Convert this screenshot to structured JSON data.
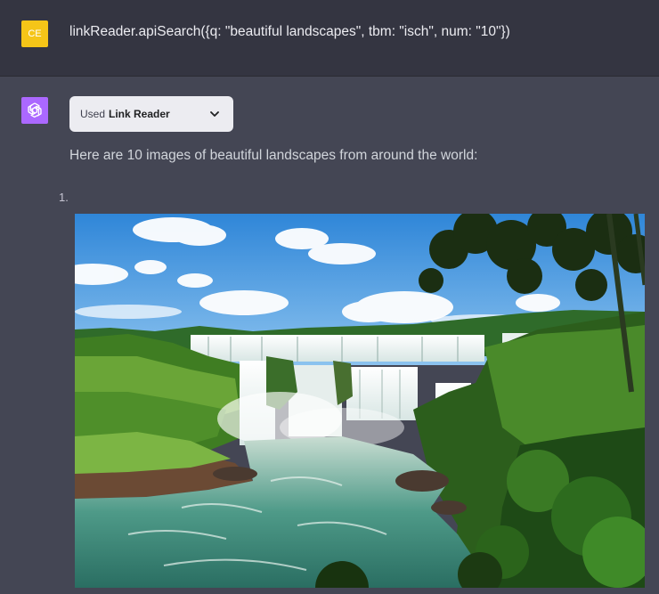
{
  "user_message": {
    "avatar_initials": "CE",
    "avatar_color": "#f5c518",
    "text": "linkReader.apiSearch({q: \"beautiful landscapes\", tbm: \"isch\", num: \"10\"})"
  },
  "assistant": {
    "avatar_icon": "openai-logo-icon",
    "avatar_color": "#ab68ff",
    "plugin_chip": {
      "prefix": "Used",
      "plugin_name": "Link Reader",
      "icon": "chevron-down-icon"
    },
    "intro_text": "Here are 10 images of beautiful landscapes from around the world:",
    "list": [
      {
        "number": "1.",
        "image_subject": "tropical waterfalls in lush rainforest"
      }
    ]
  },
  "colors": {
    "user_row_bg": "#343541",
    "assistant_row_bg": "#444654",
    "chip_bg": "#ececf1"
  }
}
